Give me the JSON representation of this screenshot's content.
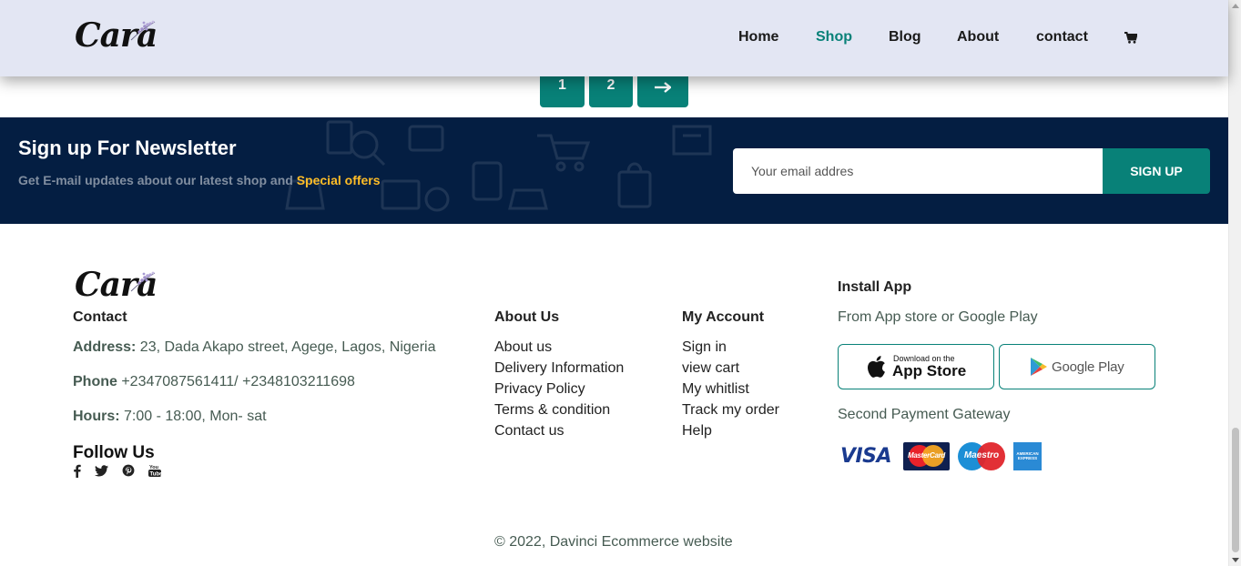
{
  "brand": {
    "logo_text": "Cara"
  },
  "nav": {
    "items": [
      {
        "label": "Home",
        "active": false
      },
      {
        "label": "Shop",
        "active": true
      },
      {
        "label": "Blog",
        "active": false
      },
      {
        "label": "About",
        "active": false
      },
      {
        "label": "contact",
        "active": false
      }
    ],
    "cart_icon": "shopping-cart-icon"
  },
  "pagination": {
    "pages": [
      "1",
      "2"
    ],
    "next_icon": "long-arrow-right-icon"
  },
  "newsletter": {
    "title": "Sign up For Newsletter",
    "subtitle": "Get E-mail updates about our latest shop and",
    "highlight": "Special offers",
    "input_placeholder": "Your email addres",
    "button_label": "SIGN UP"
  },
  "footer": {
    "contact": {
      "heading": "Contact",
      "address_label": "Address:",
      "address_value": " 23, Dada Akapo street, Agege, Lagos, Nigeria",
      "phone_label": "Phone",
      "phone_value": " +2347087561411/ +2348103211698",
      "hours_label": "Hours:",
      "hours_value": " 7:00 - 18:00, Mon- sat"
    },
    "follow": {
      "heading": "Follow Us",
      "icons": [
        "facebook-icon",
        "twitter-icon",
        "pinterest-icon",
        "youtube-icon"
      ]
    },
    "about": {
      "heading": "About Us",
      "links": [
        "About us",
        "Delivery Information",
        "Privacy Policy",
        "Terms & condition",
        "Contact us"
      ]
    },
    "account": {
      "heading": "My Account",
      "links": [
        "Sign in",
        "view cart",
        "My whitlist",
        "Track my order",
        "Help"
      ]
    },
    "install": {
      "heading": "Install App",
      "subtitle": "From App store or Google Play",
      "app_store": {
        "small": "Download on the",
        "big": "App Store"
      },
      "google_play": {
        "label": "Google Play"
      },
      "payment_heading": "Second Payment Gateway",
      "payment_icons": [
        "visa-logo",
        "mastercard-logo",
        "maestro-logo",
        "american-express-logo"
      ],
      "visa_text": "VISA",
      "mastercard_text": "MasterCard",
      "maestro_text": "Maestro",
      "amex_text": "AMERICAN EXPRESS"
    },
    "copyright": "© 2022, Davinci Ecommerce website"
  },
  "colors": {
    "accent": "#088178",
    "header_bg": "#e3e6f3",
    "newsletter_bg": "#041e42",
    "highlight": "#ffbd27"
  }
}
